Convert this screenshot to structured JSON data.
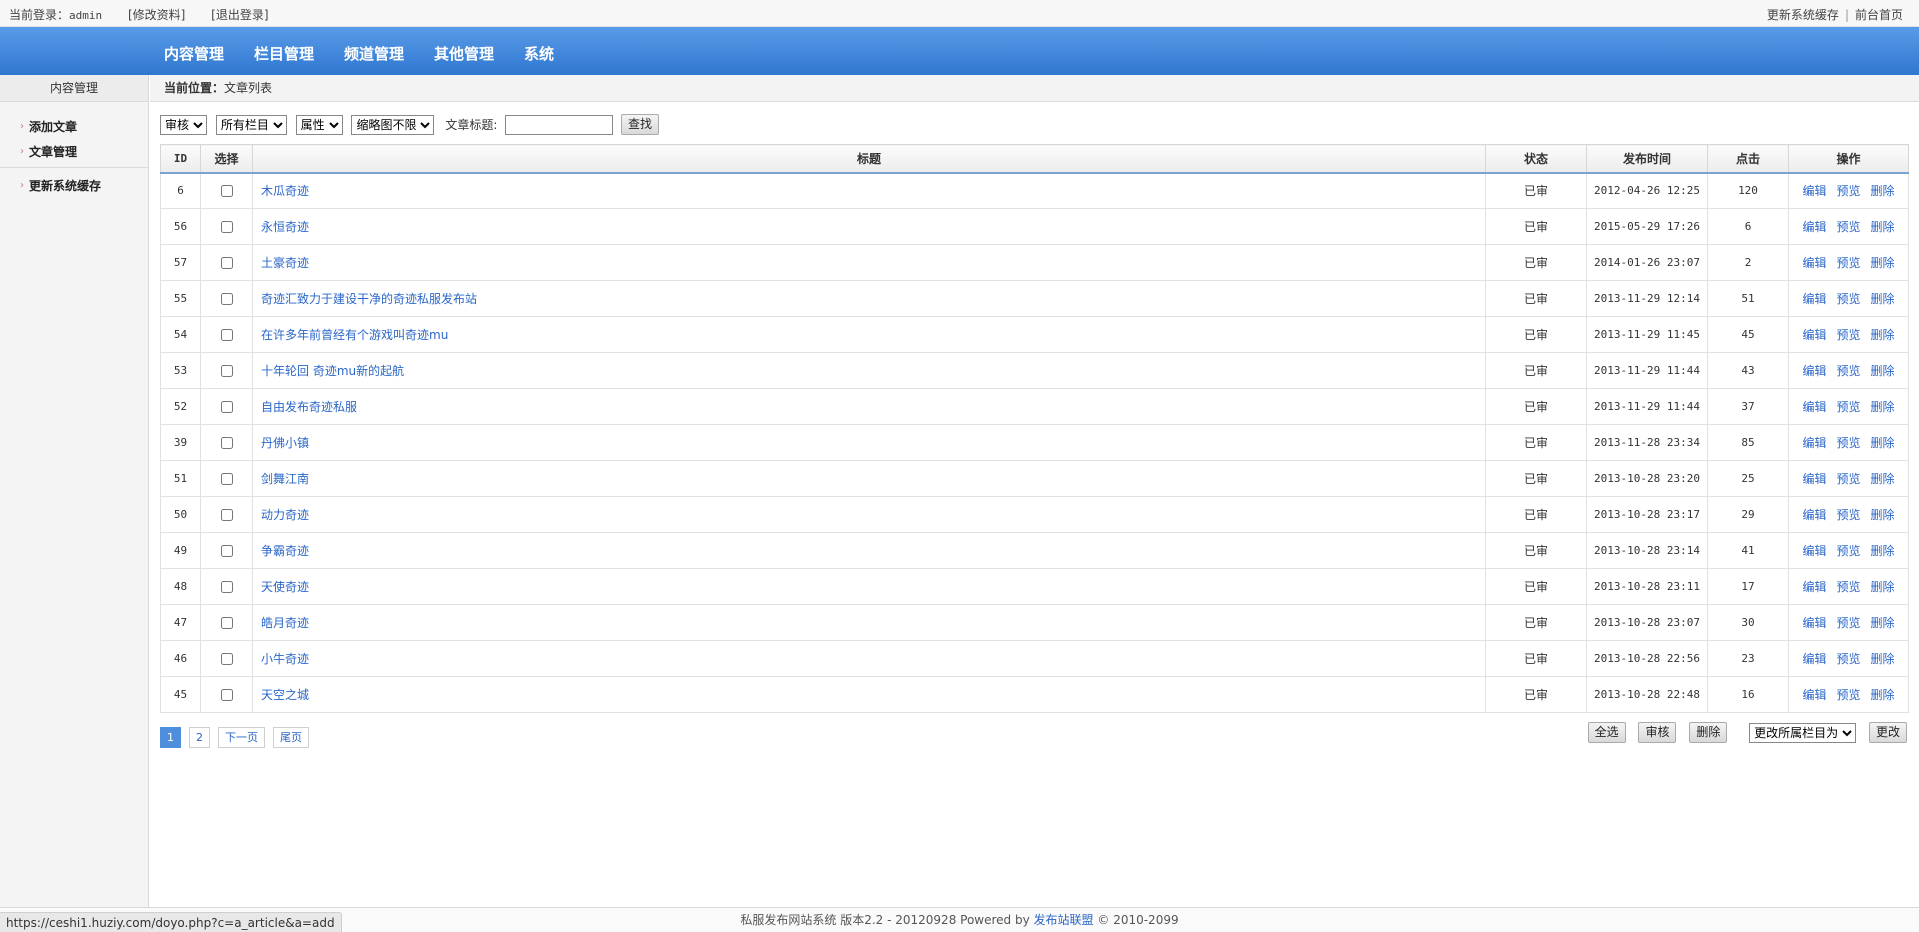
{
  "topbar": {
    "login_label": "当前登录：",
    "username": "admin",
    "edit_profile": "[修改资料]",
    "logout": "[退出登录]",
    "refresh_cache": "更新系统缓存",
    "separator": "|",
    "frontend_home": "前台首页"
  },
  "nav": {
    "items": [
      "内容管理",
      "栏目管理",
      "频道管理",
      "其他管理",
      "系统"
    ]
  },
  "sidebar": {
    "title": "内容管理",
    "items": [
      "添加文章",
      "文章管理"
    ],
    "extra": "更新系统缓存"
  },
  "breadcrumb": {
    "label": "当前位置：",
    "current": "文章列表"
  },
  "filters": {
    "status_select": "审核",
    "column_select": "所有栏目",
    "attr_select": "属性",
    "thumb_select": "缩略图不限",
    "title_label": "文章标题:",
    "title_value": "",
    "search_button": "查找"
  },
  "table": {
    "headers": {
      "id": "ID",
      "select": "选择",
      "title": "标题",
      "status": "状态",
      "date": "发布时间",
      "clicks": "点击",
      "ops": "操作"
    },
    "op_labels": {
      "edit": "编辑",
      "preview": "预览",
      "delete": "删除"
    },
    "rows": [
      {
        "id": "6",
        "title": "木瓜奇迹",
        "status": "已审",
        "date": "2012-04-26 12:25",
        "clicks": "120"
      },
      {
        "id": "56",
        "title": "永恒奇迹",
        "status": "已审",
        "date": "2015-05-29 17:26",
        "clicks": "6"
      },
      {
        "id": "57",
        "title": "土豪奇迹",
        "status": "已审",
        "date": "2014-01-26 23:07",
        "clicks": "2"
      },
      {
        "id": "55",
        "title": "奇迹汇致力于建设干净的奇迹私服发布站",
        "status": "已审",
        "date": "2013-11-29 12:14",
        "clicks": "51"
      },
      {
        "id": "54",
        "title": "在许多年前曾经有个游戏叫奇迹mu",
        "status": "已审",
        "date": "2013-11-29 11:45",
        "clicks": "45"
      },
      {
        "id": "53",
        "title": "十年轮回 奇迹mu新的起航",
        "status": "已审",
        "date": "2013-11-29 11:44",
        "clicks": "43"
      },
      {
        "id": "52",
        "title": "自由发布奇迹私服",
        "status": "已审",
        "date": "2013-11-29 11:44",
        "clicks": "37"
      },
      {
        "id": "39",
        "title": "丹佛小镇",
        "status": "已审",
        "date": "2013-11-28 23:34",
        "clicks": "85"
      },
      {
        "id": "51",
        "title": "剑舞江南",
        "status": "已审",
        "date": "2013-10-28 23:20",
        "clicks": "25"
      },
      {
        "id": "50",
        "title": "动力奇迹",
        "status": "已审",
        "date": "2013-10-28 23:17",
        "clicks": "29"
      },
      {
        "id": "49",
        "title": "争霸奇迹",
        "status": "已审",
        "date": "2013-10-28 23:14",
        "clicks": "41"
      },
      {
        "id": "48",
        "title": "天使奇迹",
        "status": "已审",
        "date": "2013-10-28 23:11",
        "clicks": "17"
      },
      {
        "id": "47",
        "title": "皓月奇迹",
        "status": "已审",
        "date": "2013-10-28 23:07",
        "clicks": "30"
      },
      {
        "id": "46",
        "title": "小牛奇迹",
        "status": "已审",
        "date": "2013-10-28 22:56",
        "clicks": "23"
      },
      {
        "id": "45",
        "title": "天空之城",
        "status": "已审",
        "date": "2013-10-28 22:48",
        "clicks": "16"
      }
    ]
  },
  "pager": {
    "pages": [
      "1",
      "2"
    ],
    "current": "1",
    "next": "下一页",
    "last": "尾页"
  },
  "actions": {
    "select_all": "全选",
    "approve": "审核",
    "delete": "删除",
    "move_select": "更改所属栏目为",
    "change": "更改"
  },
  "footer": {
    "text": "私服发布网站系统 版本2.2 - 20120928 Powered by",
    "link": "发布站联盟",
    "copyright": "© 2010-2099"
  },
  "statusbar": {
    "url": "https://ceshi1.huziy.com/doyo.php?c=a_article&a=add"
  }
}
